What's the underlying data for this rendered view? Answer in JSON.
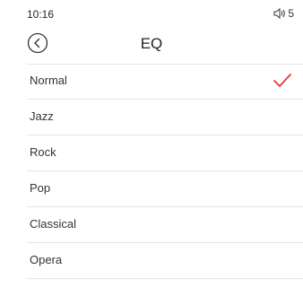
{
  "status_bar": {
    "time": "10:16",
    "volume_level": "5",
    "volume_icon": "speaker-icon"
  },
  "header": {
    "back_icon": "back-circle-icon",
    "title": "EQ"
  },
  "eq_options": [
    {
      "label": "Normal",
      "selected": true
    },
    {
      "label": "Jazz",
      "selected": false
    },
    {
      "label": "Rock",
      "selected": false
    },
    {
      "label": "Pop",
      "selected": false
    },
    {
      "label": "Classical",
      "selected": false
    },
    {
      "label": "Opera",
      "selected": false
    }
  ],
  "colors": {
    "check": "#e53935",
    "divider": "#e6e6e6"
  }
}
